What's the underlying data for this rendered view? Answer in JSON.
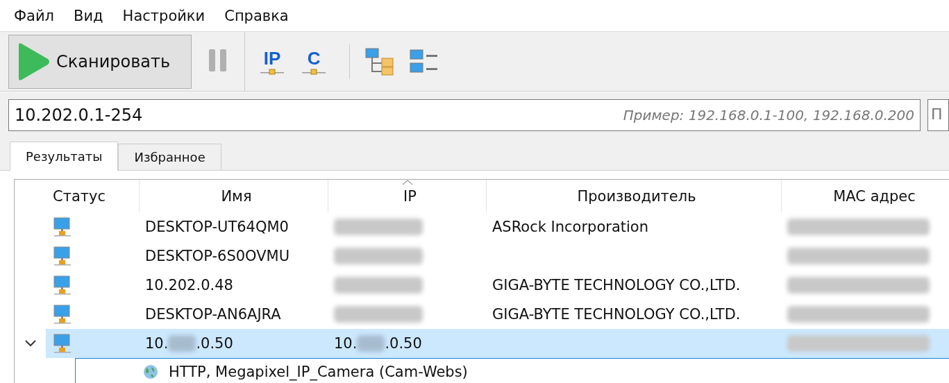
{
  "menu": [
    "Файл",
    "Вид",
    "Настройки",
    "Справка"
  ],
  "toolbar": {
    "scan_label": "Сканировать",
    "pause_disabled": true,
    "ip_label": "IP",
    "class_label": "C"
  },
  "address": {
    "value": "10.202.0.1-254",
    "placeholder": "Пример: 192.168.0.1-100, 192.168.0.200",
    "next_field_text": "П"
  },
  "tabs": [
    {
      "label": "Результаты",
      "selected": true
    },
    {
      "label": "Избранное",
      "selected": false
    }
  ],
  "table": {
    "columns": [
      {
        "label": "Статус",
        "sorted": false
      },
      {
        "label": "Имя",
        "sorted": false
      },
      {
        "label": "IP",
        "sorted": true
      },
      {
        "label": "Производитель",
        "sorted": false
      },
      {
        "label": "MAC адрес",
        "sorted": false
      }
    ],
    "rows": [
      {
        "name": [
          {
            "kind": "text",
            "text": "DESKTOP-UT64QM0"
          }
        ],
        "ip": [
          {
            "kind": "blur"
          }
        ],
        "vendor": [
          {
            "kind": "text",
            "text": "ASRock Incorporation"
          }
        ],
        "mac": [
          {
            "kind": "blur"
          }
        ],
        "selected": false
      },
      {
        "name": [
          {
            "kind": "text",
            "text": "DESKTOP-6S0OVMU"
          }
        ],
        "ip": [
          {
            "kind": "blur"
          }
        ],
        "vendor": [],
        "mac": [
          {
            "kind": "blur"
          }
        ],
        "selected": false
      },
      {
        "name": [
          {
            "kind": "text",
            "text": "10.202.0.48"
          }
        ],
        "ip": [
          {
            "kind": "blur"
          }
        ],
        "vendor": [
          {
            "kind": "text",
            "text": "GIGA-BYTE TECHNOLOGY CO.,LTD."
          }
        ],
        "mac": [
          {
            "kind": "blur"
          }
        ],
        "selected": false
      },
      {
        "name": [
          {
            "kind": "text",
            "text": "DESKTOP-AN6AJRA"
          }
        ],
        "ip": [
          {
            "kind": "blur"
          }
        ],
        "vendor": [
          {
            "kind": "text",
            "text": "GIGA-BYTE TECHNOLOGY CO.,LTD."
          }
        ],
        "mac": [
          {
            "kind": "blur"
          }
        ],
        "selected": false
      },
      {
        "name": [
          {
            "kind": "text",
            "text": "10."
          },
          {
            "kind": "blur"
          },
          {
            "kind": "text",
            "text": ".0.50"
          }
        ],
        "ip": [
          {
            "kind": "text",
            "text": "10."
          },
          {
            "kind": "blur"
          },
          {
            "kind": "text",
            "text": ".0.50"
          }
        ],
        "vendor": [],
        "mac": [
          {
            "kind": "blur"
          }
        ],
        "selected": true,
        "expanded": true,
        "children": [
          {
            "label": "HTTP, Megapixel_IP_Camera (Cam-Webs)"
          }
        ]
      }
    ]
  }
}
